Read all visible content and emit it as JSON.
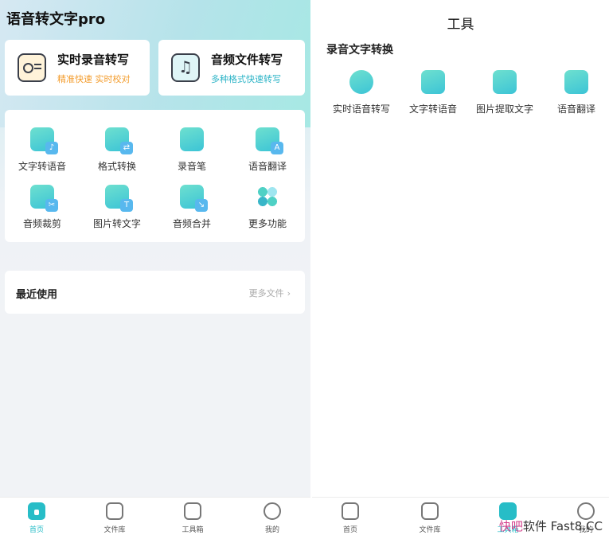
{
  "left": {
    "app_title": "语音转文字pro",
    "feature_cards": [
      {
        "title": "实时录音转写",
        "subtitle": "精准快速 实时校对",
        "icon": "radio-icon"
      },
      {
        "title": "音频文件转写",
        "subtitle": "多种格式快速转写",
        "icon": "music-file-icon"
      }
    ],
    "tools": [
      {
        "label": "文字转语音",
        "icon": "text-to-speech-icon",
        "badge": "♪"
      },
      {
        "label": "格式转换",
        "icon": "format-convert-icon",
        "badge": "⇄"
      },
      {
        "label": "录音笔",
        "icon": "recorder-icon",
        "badge": ""
      },
      {
        "label": "语音翻译",
        "icon": "translate-icon",
        "badge": "A"
      },
      {
        "label": "音频裁剪",
        "icon": "audio-cut-icon",
        "badge": "✂"
      },
      {
        "label": "图片转文字",
        "icon": "image-to-text-icon",
        "badge": "T"
      },
      {
        "label": "音频合并",
        "icon": "audio-merge-icon",
        "badge": "↘"
      },
      {
        "label": "更多功能",
        "icon": "more-icon",
        "badge": ""
      }
    ],
    "recent": {
      "title": "最近使用",
      "more": "更多文件",
      "chevron": "›"
    },
    "nav": [
      {
        "label": "首页",
        "icon": "home-icon",
        "active": true
      },
      {
        "label": "文件库",
        "icon": "file-library-icon",
        "active": false
      },
      {
        "label": "工具箱",
        "icon": "toolbox-icon",
        "active": false
      },
      {
        "label": "我的",
        "icon": "profile-icon",
        "active": false
      }
    ]
  },
  "right": {
    "title": "工具",
    "section_title": "录音文字转换",
    "tools": [
      {
        "label": "实时语音转写",
        "icon": "realtime-transcribe-icon"
      },
      {
        "label": "文字转语音",
        "icon": "text-to-speech-icon"
      },
      {
        "label": "图片提取文字",
        "icon": "image-extract-text-icon"
      },
      {
        "label": "语音翻译",
        "icon": "voice-translate-icon"
      }
    ],
    "nav": [
      {
        "label": "首页",
        "icon": "home-icon",
        "active": false
      },
      {
        "label": "文件库",
        "icon": "file-library-icon",
        "active": false
      },
      {
        "label": "工具箱",
        "icon": "toolbox-icon",
        "active": true
      },
      {
        "label": "我的",
        "icon": "profile-icon",
        "active": false
      }
    ]
  },
  "watermark": {
    "part1": "快吧",
    "part2": "软件 Fast8.CC"
  },
  "colors": {
    "accent": "#27bdc7",
    "orange": "#f39c2c",
    "cyan_text": "#2ab3c6"
  }
}
